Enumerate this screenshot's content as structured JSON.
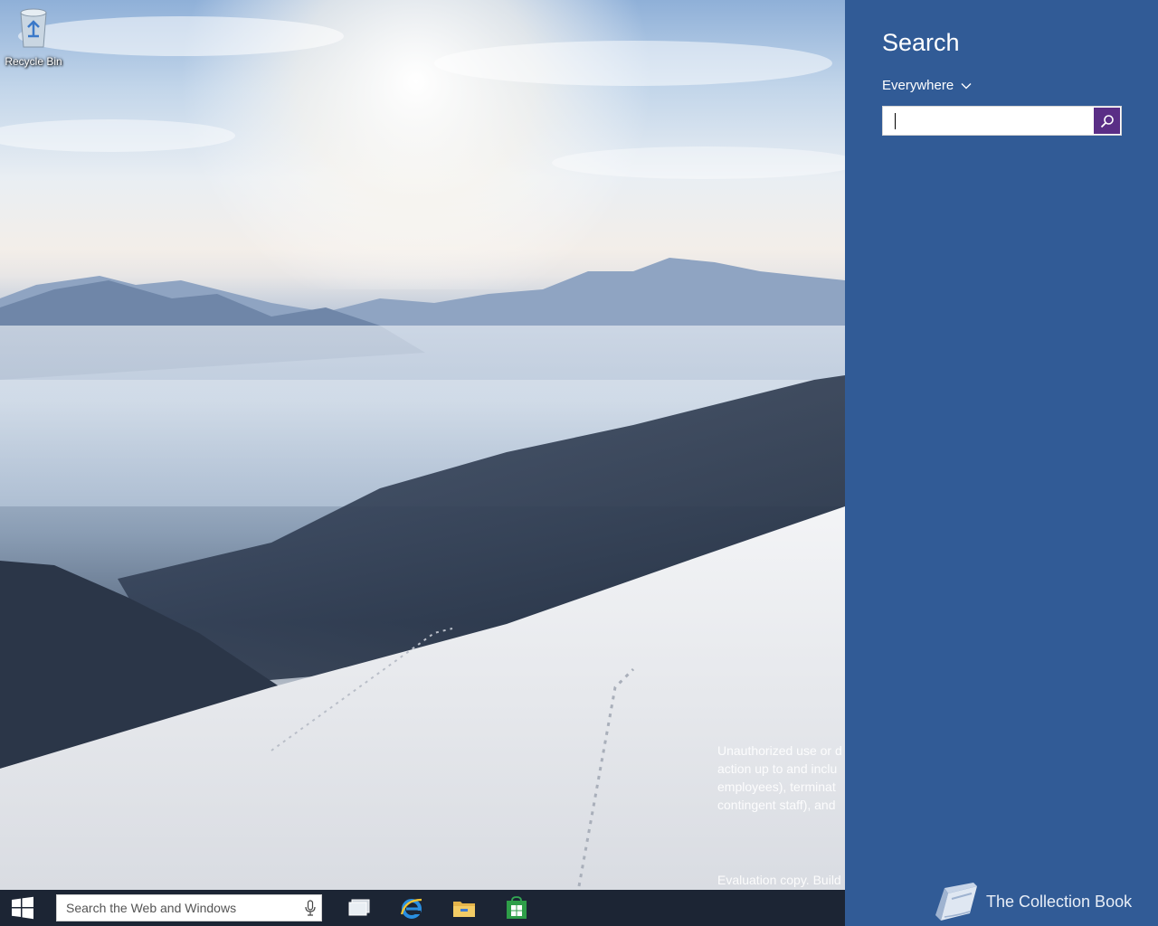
{
  "desktop": {
    "icons": [
      {
        "label": "Recycle Bin",
        "icon": "recycle-bin-icon"
      }
    ],
    "watermark": {
      "lines": [
        "Unauthorized use or d",
        "action up to and inclu",
        "employees), terminat",
        "contingent staff), and"
      ],
      "build": "Evaluation copy. Build"
    }
  },
  "taskbar": {
    "search_placeholder": "Search the Web and Windows",
    "apps": [
      "task-view-icon",
      "internet-explorer-icon",
      "file-explorer-icon",
      "store-icon"
    ]
  },
  "charm": {
    "title": "Search",
    "scope": "Everywhere",
    "input_value": "",
    "accent": "#315b96",
    "button_color": "#5a2e86"
  },
  "branding": {
    "text": "The Collection Book",
    "icon": "book-icon"
  }
}
